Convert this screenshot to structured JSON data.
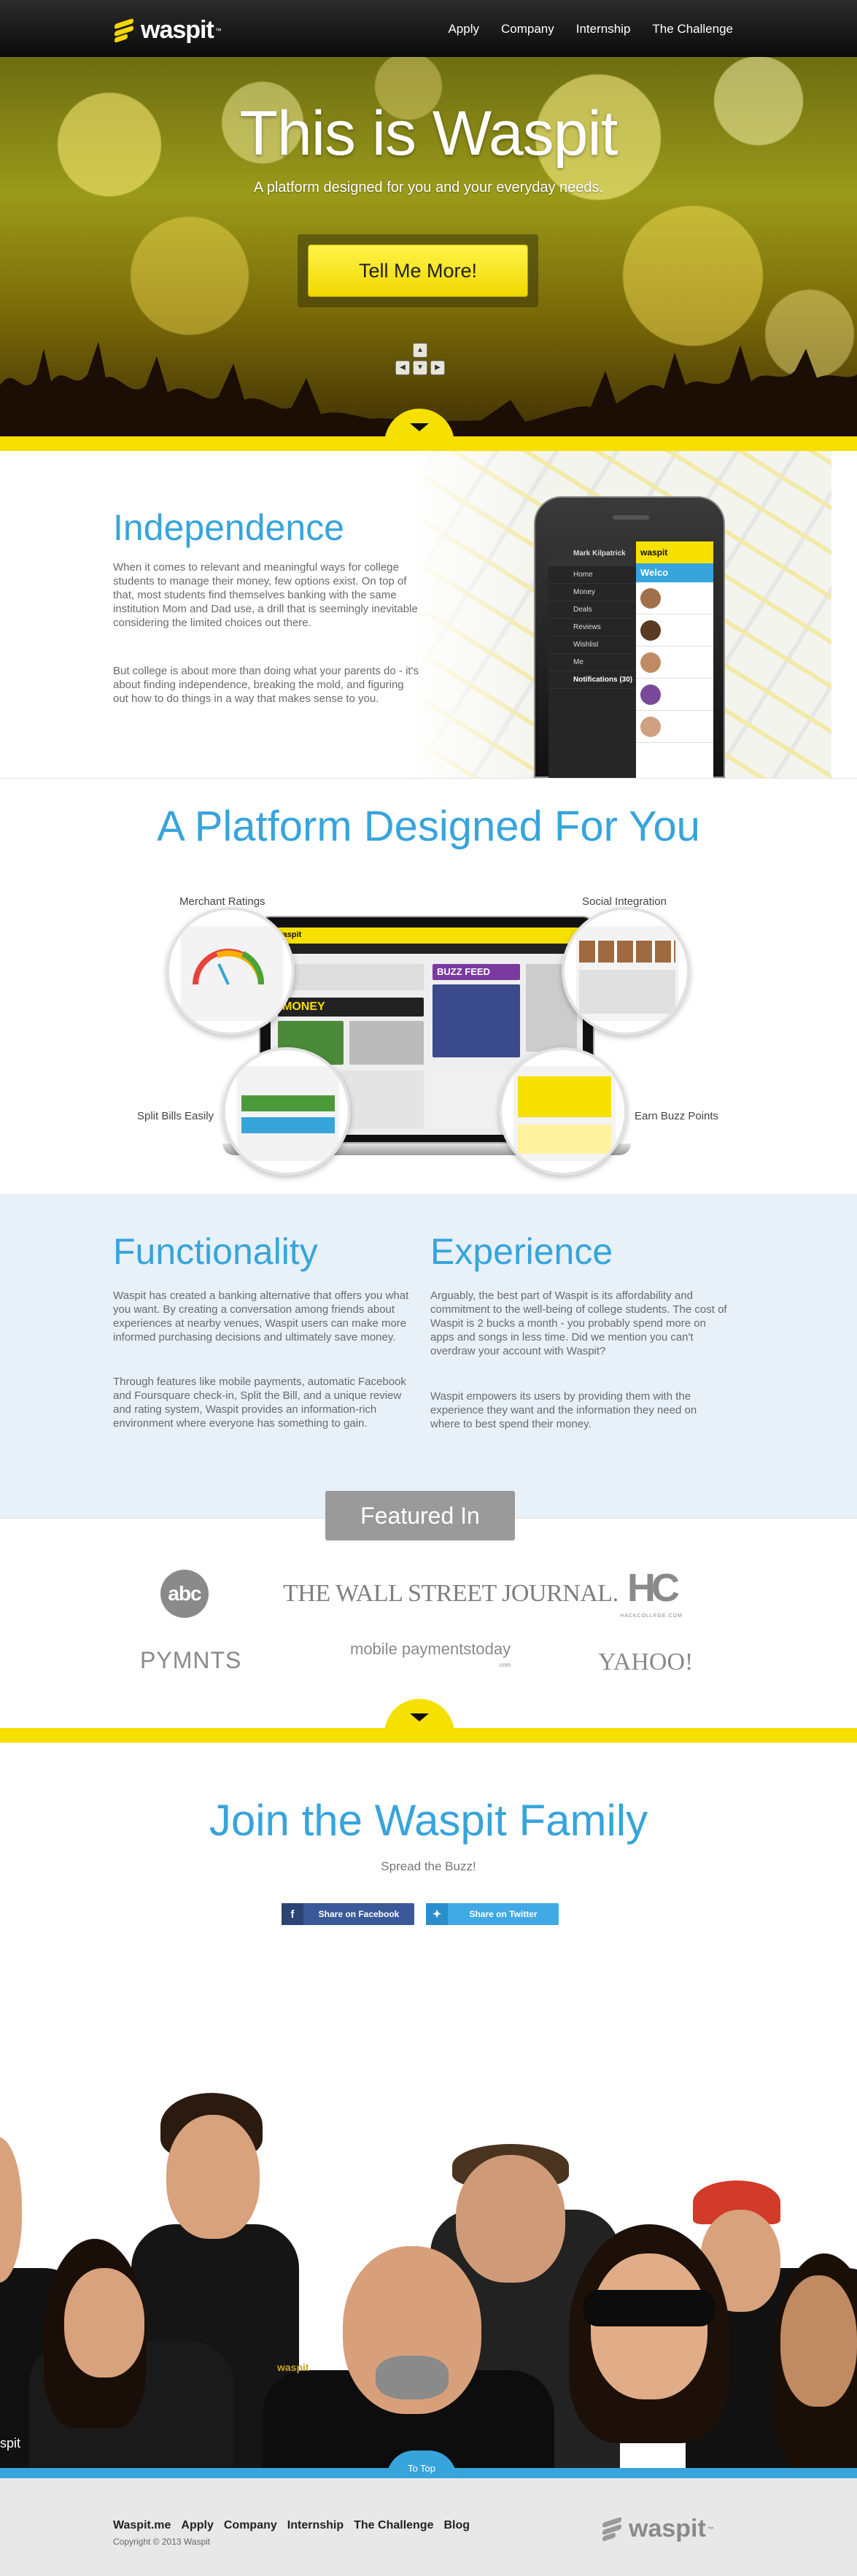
{
  "brand": {
    "name": "waspit",
    "tm": "™",
    "accent": "#f6e000",
    "blue": "#37a4dc"
  },
  "nav": {
    "items": [
      "Apply",
      "Company",
      "Internship",
      "The Challenge"
    ]
  },
  "hero": {
    "title": "This is Waspit",
    "subtitle": "A platform designed for you and your everyday needs.",
    "cta": "Tell Me More!"
  },
  "independence": {
    "heading": "Independence",
    "p1": "When it comes to relevant and meaningful ways for college students to manage their money, few options exist. On top of that, most students find themselves banking with the same institution Mom and Dad use, a drill that is seemingly inevitable considering the limited choices out there.",
    "p2": "But college is about more than doing what your parents do - it's about finding independence, breaking the mold, and figuring out how to do things in a way that makes sense to you.",
    "phone": {
      "user": "Mark Kilpatrick",
      "menu": [
        "Home",
        "Money",
        "Deals",
        "Reviews",
        "Wishlist",
        "Me"
      ],
      "notifications": "Notifications (30)",
      "header": "waspit",
      "welcome": "Welco"
    }
  },
  "platform": {
    "heading": "A Platform Designed For You",
    "labels": {
      "merchant": "Merchant Ratings",
      "social": "Social Integration",
      "split": "Split Bills Easily",
      "buzz": "Earn Buzz Points"
    },
    "screen": {
      "brand": "waspit",
      "money": "MONEY",
      "buzz": "BUZZ FEED"
    }
  },
  "functionality": {
    "heading": "Functionality",
    "p1": "Waspit has created a banking alternative that offers you what you want. By creating a conversation among friends about experiences at nearby venues, Waspit users can make more informed purchasing decisions and ultimately save money.",
    "p2": "Through features like mobile payments, automatic Facebook and Foursquare check-in, Split the Bill, and a unique review and rating system, Waspit provides an information-rich environment where everyone has something to gain."
  },
  "experience": {
    "heading": "Experience",
    "p1": "Arguably, the best part of Waspit is its affordability and commitment to the well-being of college students. The cost of Waspit is 2 bucks a month - you probably spend more on apps and songs in less time. Did we mention you can't overdraw your account with Waspit?",
    "p2": "Waspit empowers its users by providing them with the experience they want and the information they need on where to best spend their money."
  },
  "featured": {
    "title": "Featured In",
    "logos": {
      "abc": "abc",
      "wsj": "THE WALL STREET JOURNAL.",
      "hc": "HC",
      "hc_sub": "HACKCOLLEGE.COM",
      "pymnts": "PYMNTS",
      "mpt": "mobile paymentstoday",
      "mpt_sub": ".com",
      "yahoo": "YAHOO!"
    }
  },
  "join": {
    "heading": "Join the Waspit Family",
    "sub": "Spread the Buzz!",
    "facebook": "Share on Facebook",
    "twitter": "Share on Twitter"
  },
  "team": {
    "shirt_text": "spit",
    "shirt_logo": "waspit"
  },
  "footer": {
    "to_top": "To Top",
    "links": [
      "Waspit.me",
      "Apply",
      "Company",
      "Internship",
      "The Challenge",
      "Blog"
    ],
    "copyright": "Copyright © 2013 Waspit"
  }
}
